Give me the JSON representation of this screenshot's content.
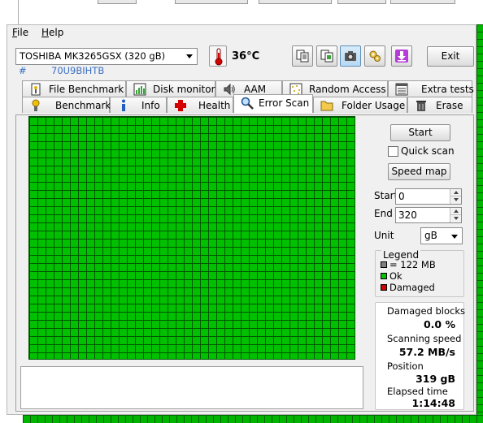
{
  "menu": {
    "file_label": "File",
    "help_label": "Help"
  },
  "drive": {
    "selected": "TOSHIBA MK3265GSX (320 gB)",
    "serial_prefix": "#",
    "serial": "70U9BIHTB"
  },
  "temperature": "36°C",
  "toolbar": {
    "icons": [
      "copy-text-icon",
      "copy-image-icon",
      "screenshot-camera-icon",
      "options-icon",
      "download-icon"
    ],
    "exit_label": "Exit"
  },
  "tabs": {
    "row1": [
      {
        "label": "File Benchmark",
        "icon": "file-benchmark-icon"
      },
      {
        "label": "Disk monitor",
        "icon": "disk-monitor-icon"
      },
      {
        "label": "AAM",
        "icon": "speaker-icon"
      },
      {
        "label": "Random Access",
        "icon": "random-access-icon"
      },
      {
        "label": "Extra tests",
        "icon": "extra-tests-icon"
      }
    ],
    "row2": [
      {
        "label": "Benchmark",
        "icon": "benchmark-icon"
      },
      {
        "label": "Info",
        "icon": "info-icon"
      },
      {
        "label": "Health",
        "icon": "health-cross-icon"
      },
      {
        "label": "Error Scan",
        "icon": "magnifier-icon",
        "selected": true
      },
      {
        "label": "Folder Usage",
        "icon": "folder-icon"
      },
      {
        "label": "Erase",
        "icon": "trash-icon"
      }
    ]
  },
  "scan": {
    "start_button": "Start",
    "quick_scan_label": "Quick scan",
    "quick_scan_checked": false,
    "speed_map_button": "Speed map",
    "start_label": "Start",
    "start_value": "0",
    "end_label": "End",
    "end_value": "320",
    "unit_label": "Unit",
    "unit_value": "gB"
  },
  "legend": {
    "title": "Legend",
    "items": [
      {
        "label": "= 122 MB",
        "color": "#808080"
      },
      {
        "label": "Ok",
        "color": "#00c000"
      },
      {
        "label": "Damaged",
        "color": "#cc0000"
      }
    ]
  },
  "stats": {
    "damaged_blocks_label": "Damaged blocks",
    "damaged_blocks_value": "0.0 %",
    "speed_label": "Scanning speed",
    "speed_value": "57.2 MB/s",
    "position_label": "Position",
    "position_value": "319 gB",
    "elapsed_label": "Elapsed time",
    "elapsed_value": "1:14:48"
  },
  "colors": {
    "block_ok": "#00c000",
    "grid_line": "#005500",
    "serial_text": "#3a6fc4"
  }
}
